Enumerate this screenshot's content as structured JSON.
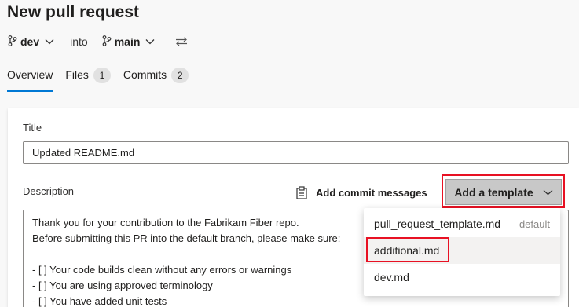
{
  "header": {
    "title": "New pull request"
  },
  "branches": {
    "source": "dev",
    "connector": "into",
    "target": "main"
  },
  "tabs": [
    {
      "label": "Overview",
      "count": null
    },
    {
      "label": "Files",
      "count": "1"
    },
    {
      "label": "Commits",
      "count": "2"
    }
  ],
  "form": {
    "title_label": "Title",
    "title_value": "Updated README.md",
    "description_label": "Description",
    "add_commit_messages": "Add commit messages",
    "add_template": "Add a template",
    "description_lines": [
      "Thank you for your contribution to the Fabrikam Fiber repo.",
      "Before submitting this PR into the default branch, please make sure:",
      "",
      "- [ ] Your code builds clean without any errors or warnings",
      "- [ ] You are using approved terminology",
      "- [ ] You have added unit tests"
    ]
  },
  "template_menu": {
    "items": [
      {
        "label": "pull_request_template.md",
        "tag": "default"
      },
      {
        "label": "additional.md",
        "tag": ""
      },
      {
        "label": "dev.md",
        "tag": ""
      }
    ]
  },
  "colors": {
    "accent": "#0078d4",
    "highlight": "#e81123"
  }
}
